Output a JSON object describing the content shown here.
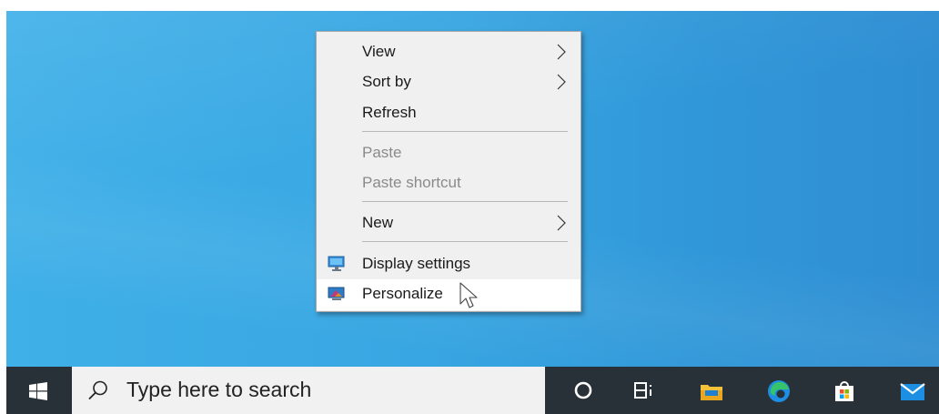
{
  "context_menu": {
    "items": [
      {
        "label": "View",
        "has_submenu": true
      },
      {
        "label": "Sort by",
        "has_submenu": true
      },
      {
        "label": "Refresh",
        "has_submenu": false
      },
      {
        "label": "Paste",
        "disabled": true
      },
      {
        "label": "Paste shortcut",
        "disabled": true
      },
      {
        "label": "New",
        "has_submenu": true
      },
      {
        "label": "Display settings",
        "icon": "display-settings-icon"
      },
      {
        "label": "Personalize",
        "icon": "personalize-icon",
        "highlighted": true
      }
    ]
  },
  "taskbar": {
    "start_icon": "windows-logo-icon",
    "search": {
      "placeholder": "Type here to search",
      "icon": "search-icon"
    },
    "buttons": [
      {
        "name": "cortana",
        "icon": "cortana-circle-icon"
      },
      {
        "name": "task-view",
        "icon": "task-view-icon"
      },
      {
        "name": "file-explorer",
        "icon": "folder-icon"
      },
      {
        "name": "edge",
        "icon": "edge-icon"
      },
      {
        "name": "store",
        "icon": "store-bag-icon"
      },
      {
        "name": "mail",
        "icon": "mail-icon"
      }
    ]
  },
  "colors": {
    "desktop": "#38a6e2",
    "taskbar": "#283038",
    "menu_background": "#f0f0f0",
    "menu_highlight": "#ffffff"
  }
}
